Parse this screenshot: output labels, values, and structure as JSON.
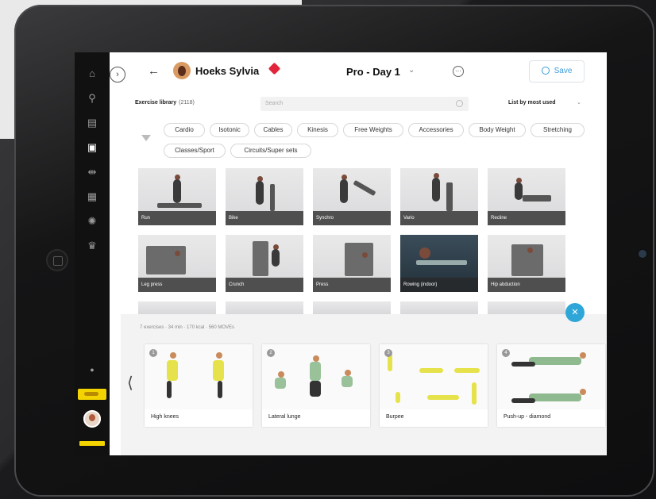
{
  "header": {
    "client_name": "Hoeks Sylvia",
    "program": "Pro - Day 1",
    "program_caret": "⌄",
    "back_icon": "←",
    "more_icon": "⋯",
    "save_label": "Save",
    "collapse_icon": "›"
  },
  "library": {
    "label": "Exercise library",
    "count": "(2118)",
    "search_placeholder": "Search",
    "sort_label": "List by most used",
    "sort_caret": "⌄"
  },
  "filters": [
    "Cardio",
    "Isotonic",
    "Cables",
    "Kinesis",
    "Free Weights",
    "Accessories",
    "Body Weight",
    "Stretching",
    "Classes/Sport",
    "Circuits/Super sets"
  ],
  "exercises": [
    "Run",
    "Bike",
    "Synchro",
    "Vario",
    "Recline",
    "Leg press",
    "Crunch",
    "Press",
    "Rowing (indoor)",
    "Hip abduction"
  ],
  "fab_icon": "✕",
  "tray": {
    "summary": "7 exercises · 34 min · 170 kcal · 560 MOVEs",
    "prev_icon": "⟨",
    "next_icon": "⟩",
    "cards": [
      {
        "label": "High knees",
        "num": "1"
      },
      {
        "label": "Lateral lunge",
        "num": "2"
      },
      {
        "label": "Burpee",
        "num": "3"
      },
      {
        "label": "Push-up - diamond",
        "num": "4"
      }
    ]
  },
  "sidenav": {
    "icons": [
      "home-icon",
      "search-icon",
      "calendar-icon",
      "profile-icon",
      "dumbbell-icon",
      "library-icon",
      "settings-icon",
      "stats-icon"
    ],
    "glyphs": [
      "⌂",
      "⚲",
      "▤",
      "▣",
      "⇹",
      "▦",
      "✺",
      "♛"
    ]
  },
  "colors": {
    "accent": "#2ea7d8",
    "brand": "#f4d400",
    "pin": "#e2253a"
  }
}
